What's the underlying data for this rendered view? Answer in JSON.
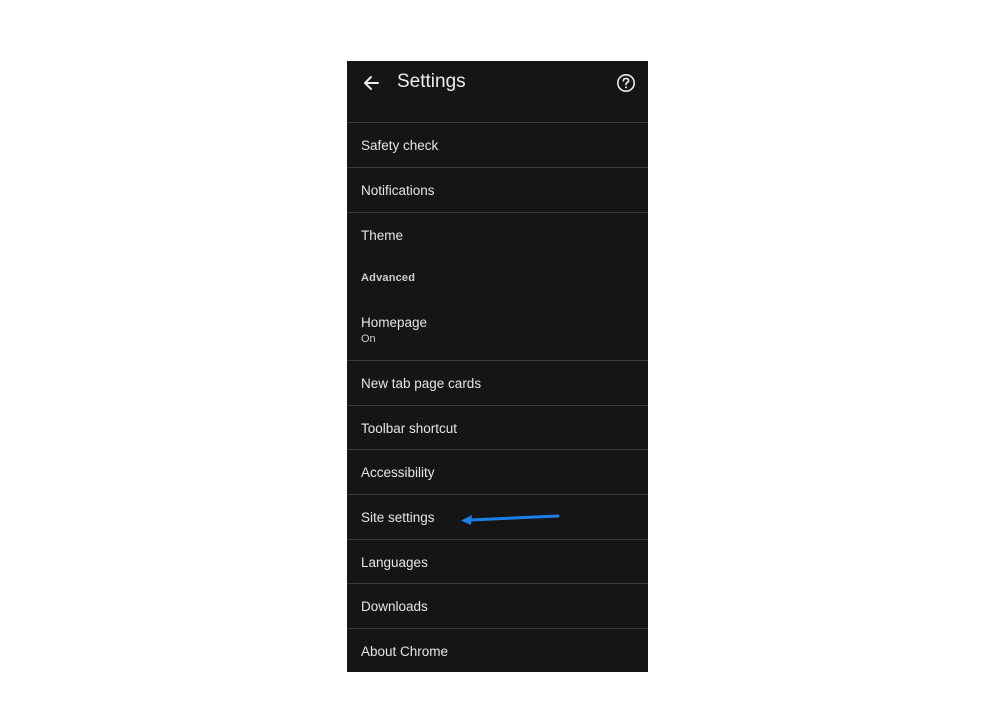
{
  "header": {
    "title": "Settings",
    "back_icon": "arrow-left-icon",
    "help_icon": "help-circle-icon"
  },
  "items": [
    {
      "label": "Safety check"
    },
    {
      "label": "Notifications"
    },
    {
      "label": "Theme"
    },
    {
      "label": "Homepage",
      "sublabel": "On"
    },
    {
      "label": "New tab page cards"
    },
    {
      "label": "Toolbar shortcut"
    },
    {
      "label": "Accessibility"
    },
    {
      "label": "Site settings"
    },
    {
      "label": "Languages"
    },
    {
      "label": "Downloads"
    },
    {
      "label": "About Chrome"
    }
  ],
  "section": {
    "advanced": "Advanced"
  },
  "annotation": {
    "arrow_color": "#1a7fe8",
    "target": "Site settings"
  }
}
